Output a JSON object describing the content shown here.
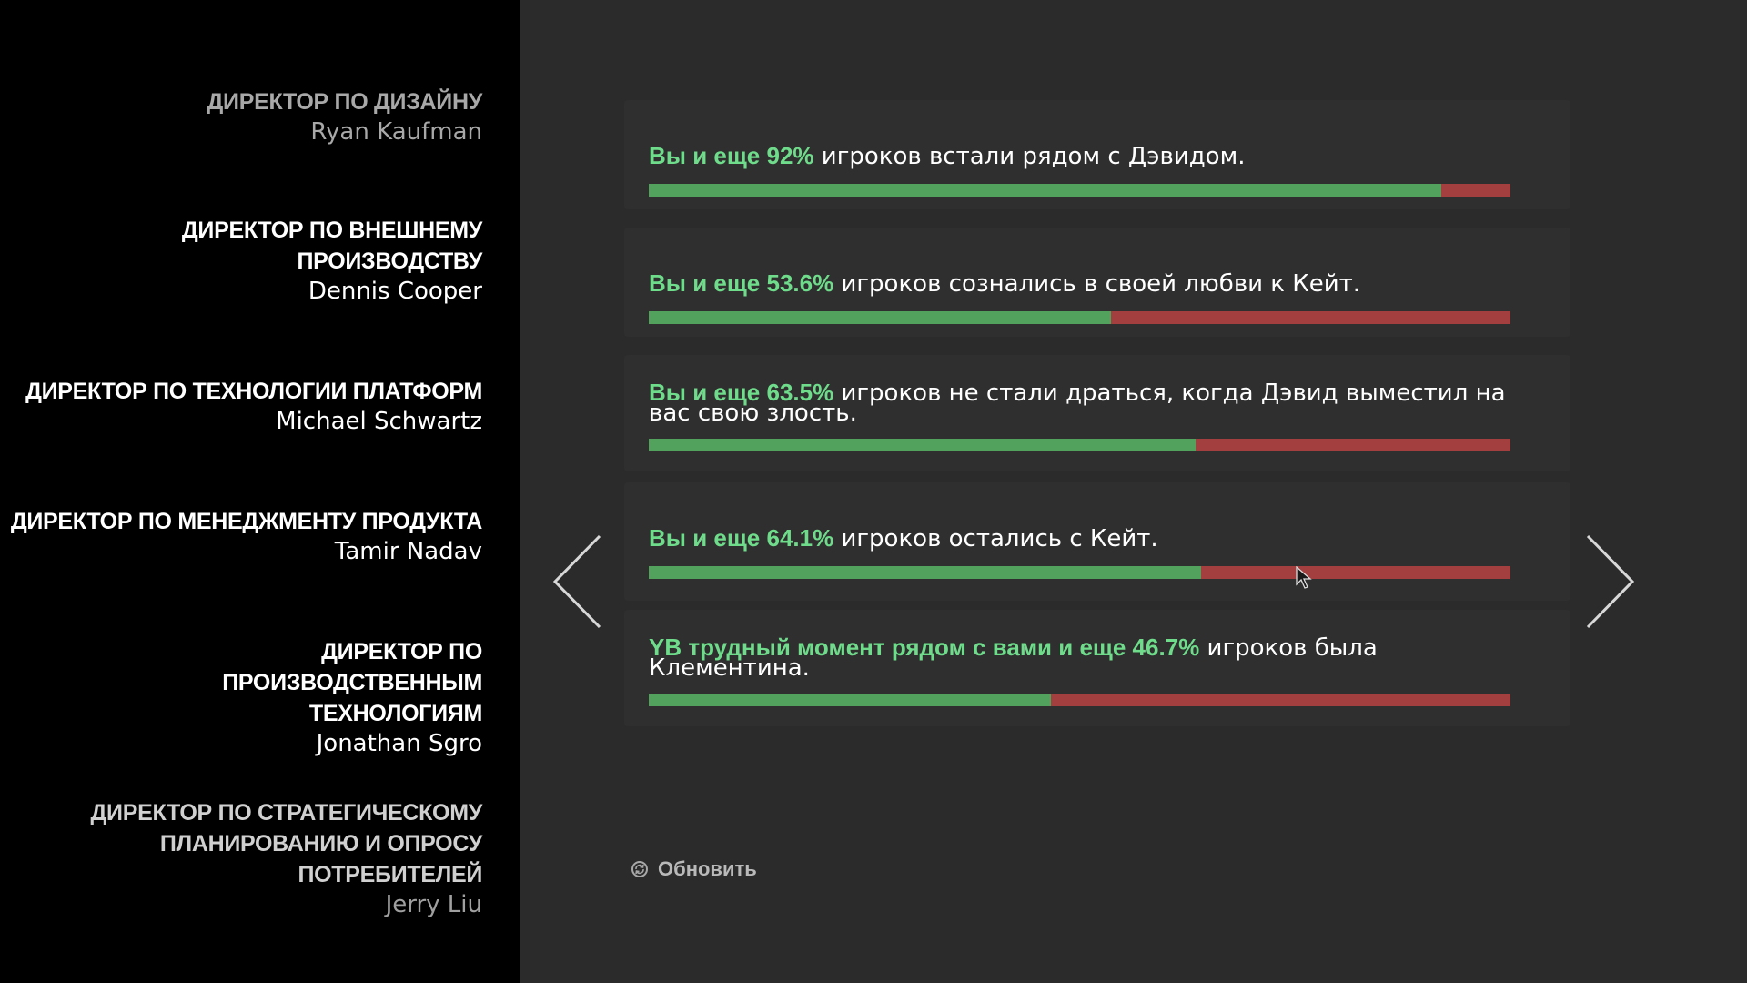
{
  "credits": [
    {
      "role": "ДИРЕКТОР ПО ДИЗАЙНУ",
      "name": "Ryan Kaufman"
    },
    {
      "role": "ДИРЕКТОР ПО ВНЕШНЕМУ ПРОИЗВОДСТВУ",
      "name": "Dennis Cooper"
    },
    {
      "role": "ДИРЕКТОР ПО ТЕХНОЛОГИИ ПЛАТФОРМ",
      "name": "Michael Schwartz"
    },
    {
      "role": "ДИРЕКТОР ПО МЕНЕДЖМЕНТУ ПРОДУКТА",
      "name": "Tamir Nadav"
    },
    {
      "role": "ДИРЕКТОР ПО ПРОИЗВОДСТВЕННЫМ ТЕХНОЛОГИЯМ",
      "name": "Jonathan Sgro"
    },
    {
      "role": "ДИРЕКТОР ПО СТРАТЕГИЧЕСКОМУ ПЛАНИРОВАНИЮ И ОПРОСУ ПОТРЕБИТЕЛЕЙ",
      "name": "Jerry Liu"
    }
  ],
  "stats": [
    {
      "highlight": "Вы и еще 92%",
      "text": " игроков встали рядом с Дэвидом.",
      "percent": 92
    },
    {
      "highlight": "Вы и еще 53.6%",
      "text": " игроков сознались в своей любви к Кейт.",
      "percent": 53.6
    },
    {
      "highlight": "Вы и еще 63.5%",
      "text": " игроков не стали драться, когда Дэвид выместил на вас свою злость.",
      "percent": 63.5
    },
    {
      "highlight": "Вы и еще 64.1%",
      "text": " игроков остались с Кейт.",
      "percent": 64.1
    },
    {
      "highlight": "YВ трудный момент рядом с вами и еще 46.7%",
      "text": " игроков была Клементина.",
      "percent": 46.7
    }
  ],
  "nav": {
    "prev_icon": "chevron-left-icon",
    "next_icon": "chevron-right-icon"
  },
  "refresh": {
    "label": "Обновить",
    "icon": "refresh-icon"
  },
  "colors": {
    "agree": "#52a25e",
    "disagree": "#a33f3f",
    "highlight_text": "#6edc8a",
    "panel_bg": "#000000",
    "page_bg": "#2b2b2b"
  }
}
